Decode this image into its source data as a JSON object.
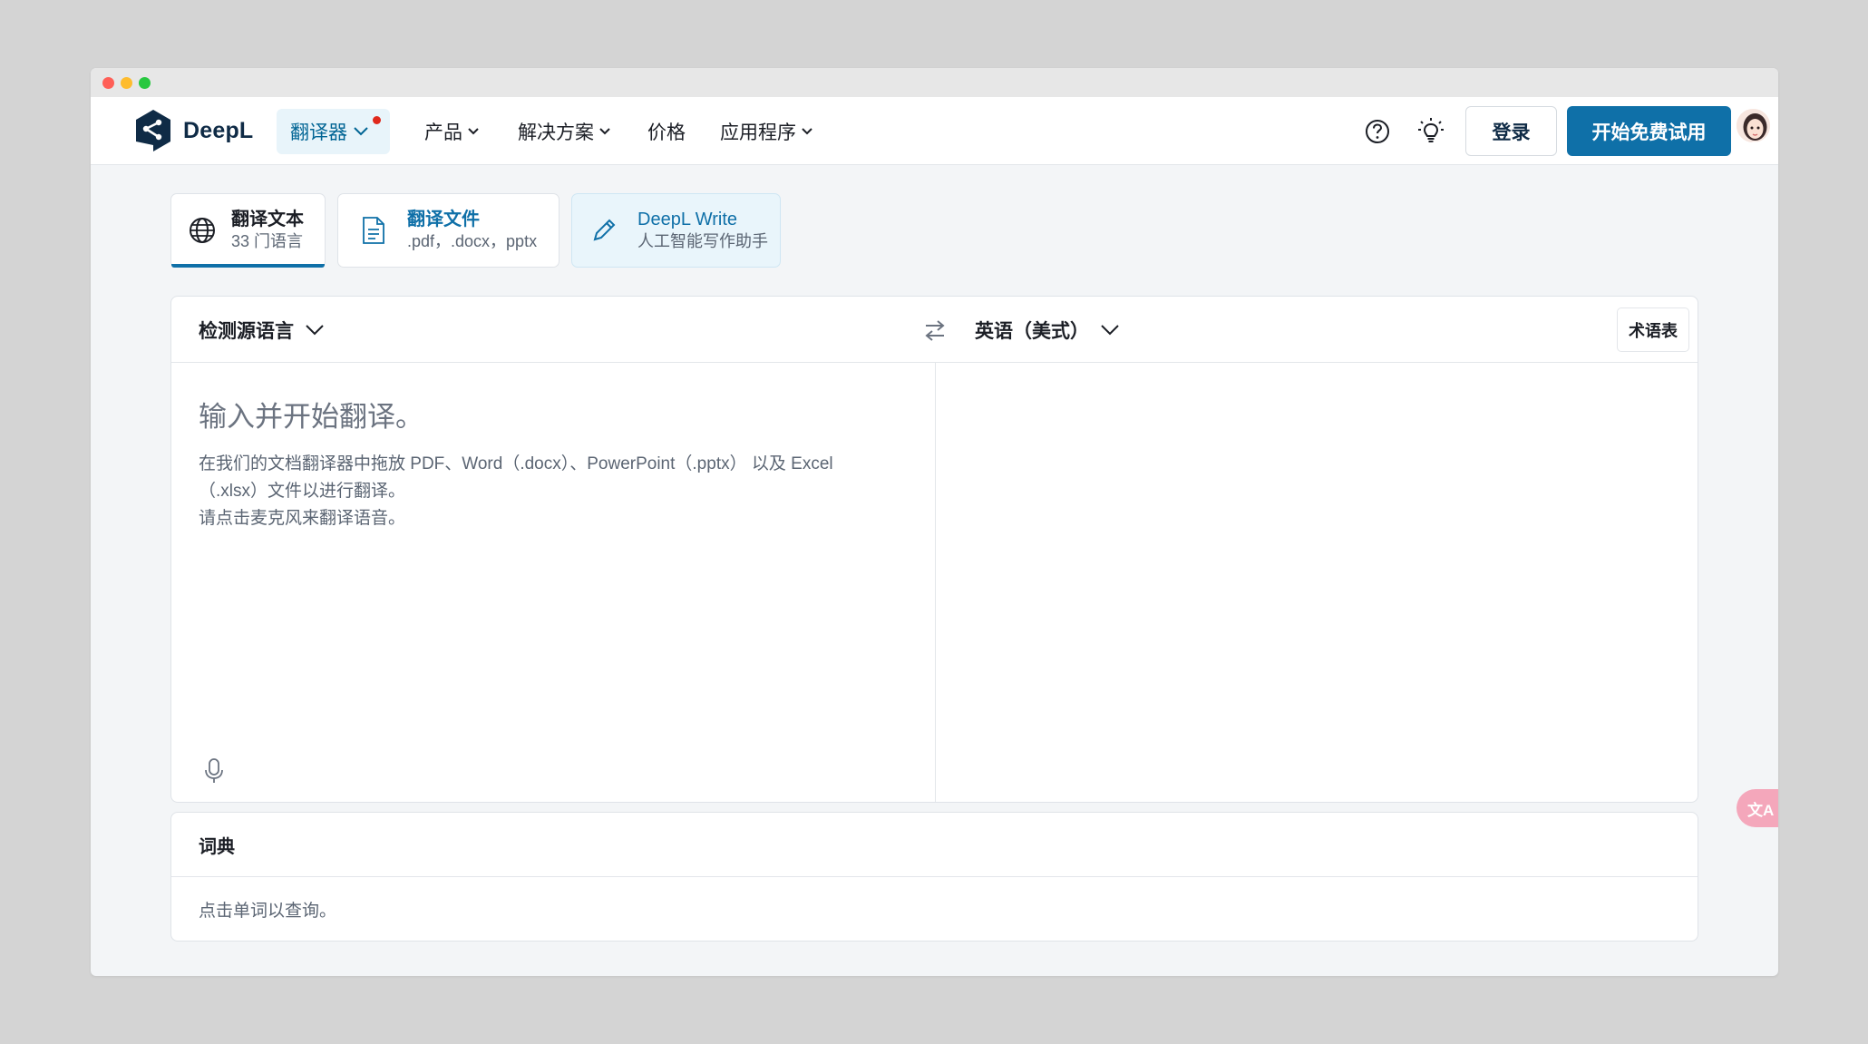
{
  "header": {
    "logo_text": "DeepL",
    "translator_label": "翻译器",
    "nav": [
      {
        "label": "产品"
      },
      {
        "label": "解决方案"
      },
      {
        "label": "价格"
      },
      {
        "label": "应用程序"
      }
    ],
    "login_label": "登录",
    "trial_label": "开始免费试用"
  },
  "tabs": [
    {
      "title": "翻译文本",
      "subtitle": "33 门语言"
    },
    {
      "title": "翻译文件",
      "subtitle": ".pdf，.docx，pptx"
    },
    {
      "title": "DeepL Write",
      "subtitle": "人工智能写作助手"
    }
  ],
  "translator": {
    "source_lang": "检测源语言",
    "target_lang": "英语（美式）",
    "glossary_label": "术语表",
    "placeholder": "输入并开始翻译。",
    "hint_lines": [
      "在我们的文档翻译器中拖放 PDF、Word（.docx）、PowerPoint（.pptx） 以及 Excel",
      "（.xlsx）文件以进行翻译。",
      "请点击麦克风来翻译语音。"
    ]
  },
  "dictionary": {
    "title": "词典",
    "hint": "点击单词以查询。"
  },
  "floating": {
    "label": "文A"
  },
  "colors": {
    "accent": "#0f70a8",
    "brand_dark": "#0f2b46",
    "badge_red": "#e0291c"
  }
}
